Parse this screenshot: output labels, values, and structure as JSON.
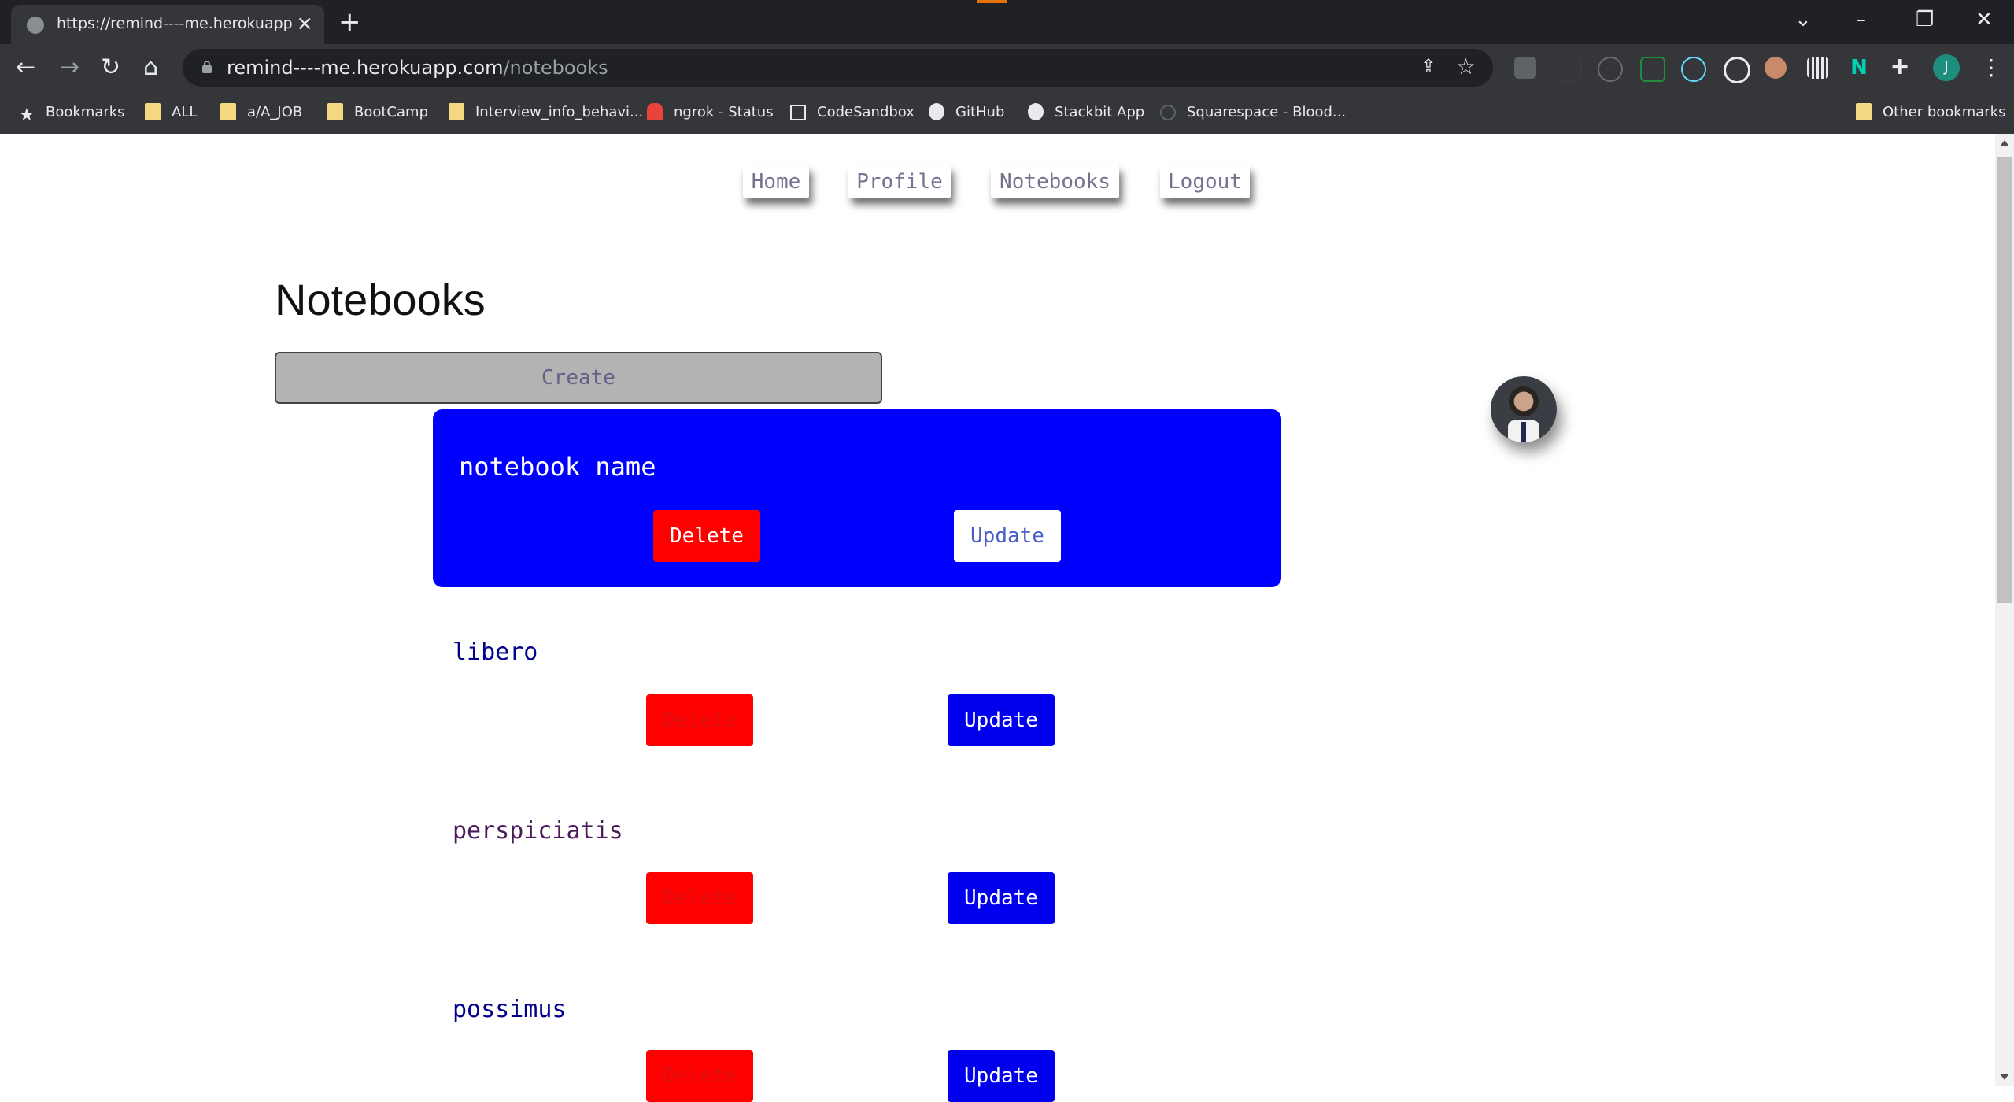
{
  "browser": {
    "tab_title": "https://remind----me.herokuapp.com",
    "url_host": "remind----me.herokuapp.com",
    "url_path": "/notebooks",
    "profile_initial": "J",
    "bookmarks": [
      {
        "label": "Bookmarks",
        "icon": "star-icon"
      },
      {
        "label": "ALL",
        "icon": "folder-icon"
      },
      {
        "label": "a/A_JOB",
        "icon": "folder-icon"
      },
      {
        "label": "BootCamp",
        "icon": "folder-icon"
      },
      {
        "label": "Interview_info_behavi...",
        "icon": "folder-icon"
      },
      {
        "label": "ngrok - Status",
        "icon": "ngrok-icon"
      },
      {
        "label": "CodeSandbox",
        "icon": "codesandbox-icon"
      },
      {
        "label": "GitHub",
        "icon": "github-icon"
      },
      {
        "label": "Stackbit App",
        "icon": "stackbit-icon"
      },
      {
        "label": "Squarespace - Blood...",
        "icon": "squarespace-icon"
      }
    ],
    "other_bookmarks": "Other bookmarks"
  },
  "nav": {
    "home": "Home",
    "profile": "Profile",
    "notebooks": "Notebooks",
    "logout": "Logout"
  },
  "page": {
    "title": "Notebooks",
    "create_label": "Create"
  },
  "new_notebook": {
    "name": "notebook name",
    "delete_label": "Delete",
    "update_label": "Update",
    "color": "#0000ff"
  },
  "notebooks": [
    {
      "name": "libero",
      "delete_label": "Delete",
      "update_label": "Update",
      "color": "#00008b"
    },
    {
      "name": "perspiciatis",
      "delete_label": "Delete",
      "update_label": "Update",
      "color": "#4b1a5a"
    },
    {
      "name": "possimus",
      "delete_label": "Delete",
      "update_label": "Update",
      "color": "#00008b"
    }
  ]
}
